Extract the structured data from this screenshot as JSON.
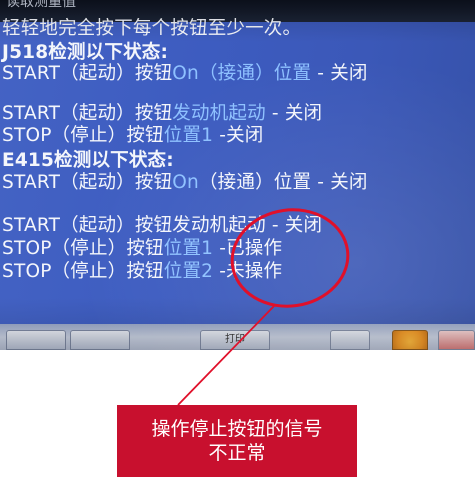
{
  "screen": {
    "title_partial": "读取测量值",
    "lines": [
      {
        "id": "instruction",
        "bold": false,
        "parts": [
          {
            "t": "轻轻地完全按下每个按钮至少一次。",
            "hl": false
          }
        ]
      },
      {
        "id": "j518-heading",
        "bold": true,
        "parts": [
          {
            "t": "J518检测以下状态:",
            "hl": false
          }
        ]
      },
      {
        "id": "j518-start-on",
        "bold": false,
        "parts": [
          {
            "t": "START（起动）按钮",
            "hl": false
          },
          {
            "t": "On（接通）位置",
            "hl": true
          },
          {
            "t": " - 关闭",
            "hl": false
          }
        ]
      },
      {
        "id": "j518-start-engine",
        "bold": false,
        "parts": [
          {
            "t": "START（起动）按钮",
            "hl": false
          },
          {
            "t": "发动机起动",
            "hl": true
          },
          {
            "t": " - 关闭",
            "hl": false
          }
        ]
      },
      {
        "id": "j518-stop-pos1",
        "bold": false,
        "parts": [
          {
            "t": "STOP（停止）按钮",
            "hl": false
          },
          {
            "t": "位置1",
            "hl": true
          },
          {
            "t": " -关闭",
            "hl": false
          }
        ]
      },
      {
        "id": "e415-heading",
        "bold": true,
        "parts": [
          {
            "t": "E415检测以下状态:",
            "hl": false
          }
        ]
      },
      {
        "id": "e415-start-on",
        "bold": false,
        "parts": [
          {
            "t": "START（起动）按钮",
            "hl": false
          },
          {
            "t": "On",
            "hl": true
          },
          {
            "t": "（接通）位置 - 关闭",
            "hl": false
          }
        ]
      },
      {
        "id": "e415-start-engine",
        "bold": false,
        "parts": [
          {
            "t": "START（起动）按钮发动机起动 - 关闭",
            "hl": false
          }
        ]
      },
      {
        "id": "e415-stop-pos1",
        "bold": false,
        "parts": [
          {
            "t": "STOP（停止）按钮",
            "hl": false
          },
          {
            "t": "位置1",
            "hl": true
          },
          {
            "t": " -已操作",
            "hl": false
          }
        ]
      },
      {
        "id": "e415-stop-pos2",
        "bold": false,
        "parts": [
          {
            "t": "STOP（停止）按钮",
            "hl": false
          },
          {
            "t": "位置2",
            "hl": true
          },
          {
            "t": " -未操作",
            "hl": false
          }
        ]
      }
    ],
    "softkeys": {
      "middle_label": "打印"
    }
  },
  "annotation": {
    "callout_line1": "操作停止按钮的信号",
    "callout_line2": "不正常",
    "colors": {
      "circle": "#e0102a",
      "callout_bg": "#c8102e",
      "arrow": "#e0102a"
    }
  },
  "colors": {
    "screen_bg": "#4463c4",
    "text": "#f4f6fb",
    "highlight": "#8ec1ff"
  }
}
